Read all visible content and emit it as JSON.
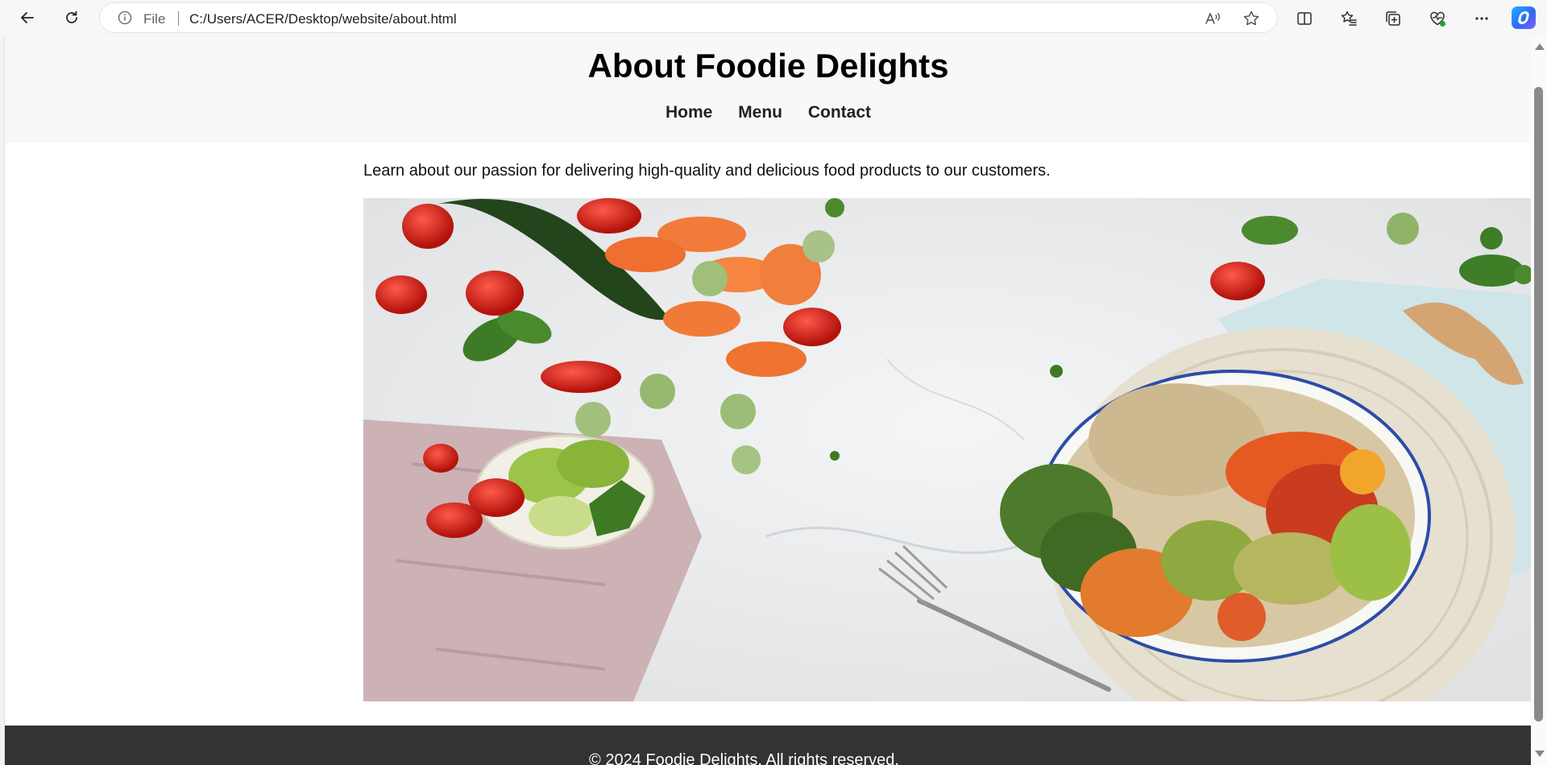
{
  "browser": {
    "address_scheme": "File",
    "address_url": "C:/Users/ACER/Desktop/website/about.html",
    "icons": [
      "back-icon",
      "refresh-icon",
      "info-icon",
      "read-aloud-icon",
      "favorite-star-icon",
      "split-screen-icon",
      "favorites-icon",
      "collections-icon",
      "browser-essentials-icon",
      "more-icon",
      "copilot-icon"
    ]
  },
  "page": {
    "title": "About Foodie Delights",
    "nav": [
      {
        "label": "Home"
      },
      {
        "label": "Menu"
      },
      {
        "label": "Contact"
      }
    ],
    "intro": "Learn about our passion for delivering high-quality and delicious food products to our customers.",
    "hero_image": "vegetables-bowl-image",
    "footer": "© 2024 Foodie Delights. All rights reserved."
  },
  "colors": {
    "header_bg": "#f8f8f8",
    "footer_bg": "#333333",
    "text": "#000000"
  }
}
